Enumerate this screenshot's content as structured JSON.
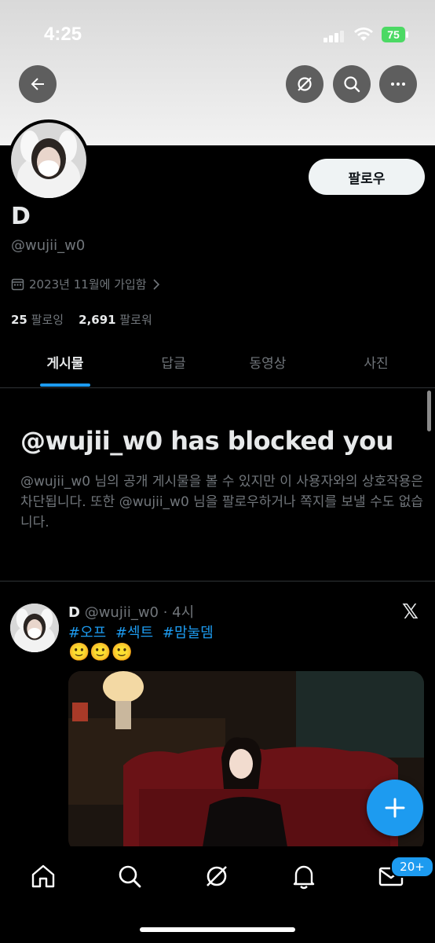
{
  "status_bar": {
    "time": "4:25",
    "battery": "75"
  },
  "profile": {
    "name": "D",
    "handle": "@wujii_w0",
    "joined": "2023년 11월에 가입함",
    "following_count": "25",
    "following_label": "팔로잉",
    "followers_count": "2,691",
    "followers_label": "팔로워",
    "follow_button": "팔로우"
  },
  "tabs": [
    {
      "label": "게시물",
      "active": true
    },
    {
      "label": "답글",
      "active": false
    },
    {
      "label": "동영상",
      "active": false
    },
    {
      "label": "사진",
      "active": false
    }
  ],
  "blocked": {
    "title": "@wujii_w0 has blocked you",
    "description": "@wujii_w0 님의 공개 게시물을 볼 수 있지만 이 사용자와의 상호작용은 차단됩니다. 또한 @wujii_w0 님을 팔로우하거나 쪽지를 보낼 수도 없습니다."
  },
  "tweet": {
    "name": "D",
    "handle": "@wujii_w0",
    "time": "· 4시",
    "hashtags": [
      "#오프",
      "#섹트",
      "#맘눌뎀"
    ],
    "emojis": "🙂🙂🙂"
  },
  "nav": {
    "items": [
      "home-icon",
      "search-icon",
      "grok-icon",
      "bell-icon",
      "mail-icon"
    ],
    "messages_badge": "20+"
  },
  "colors": {
    "accent": "#1d9bf0",
    "background": "#000000",
    "muted_text": "#71767b",
    "primary_text": "#e7e9ea"
  }
}
